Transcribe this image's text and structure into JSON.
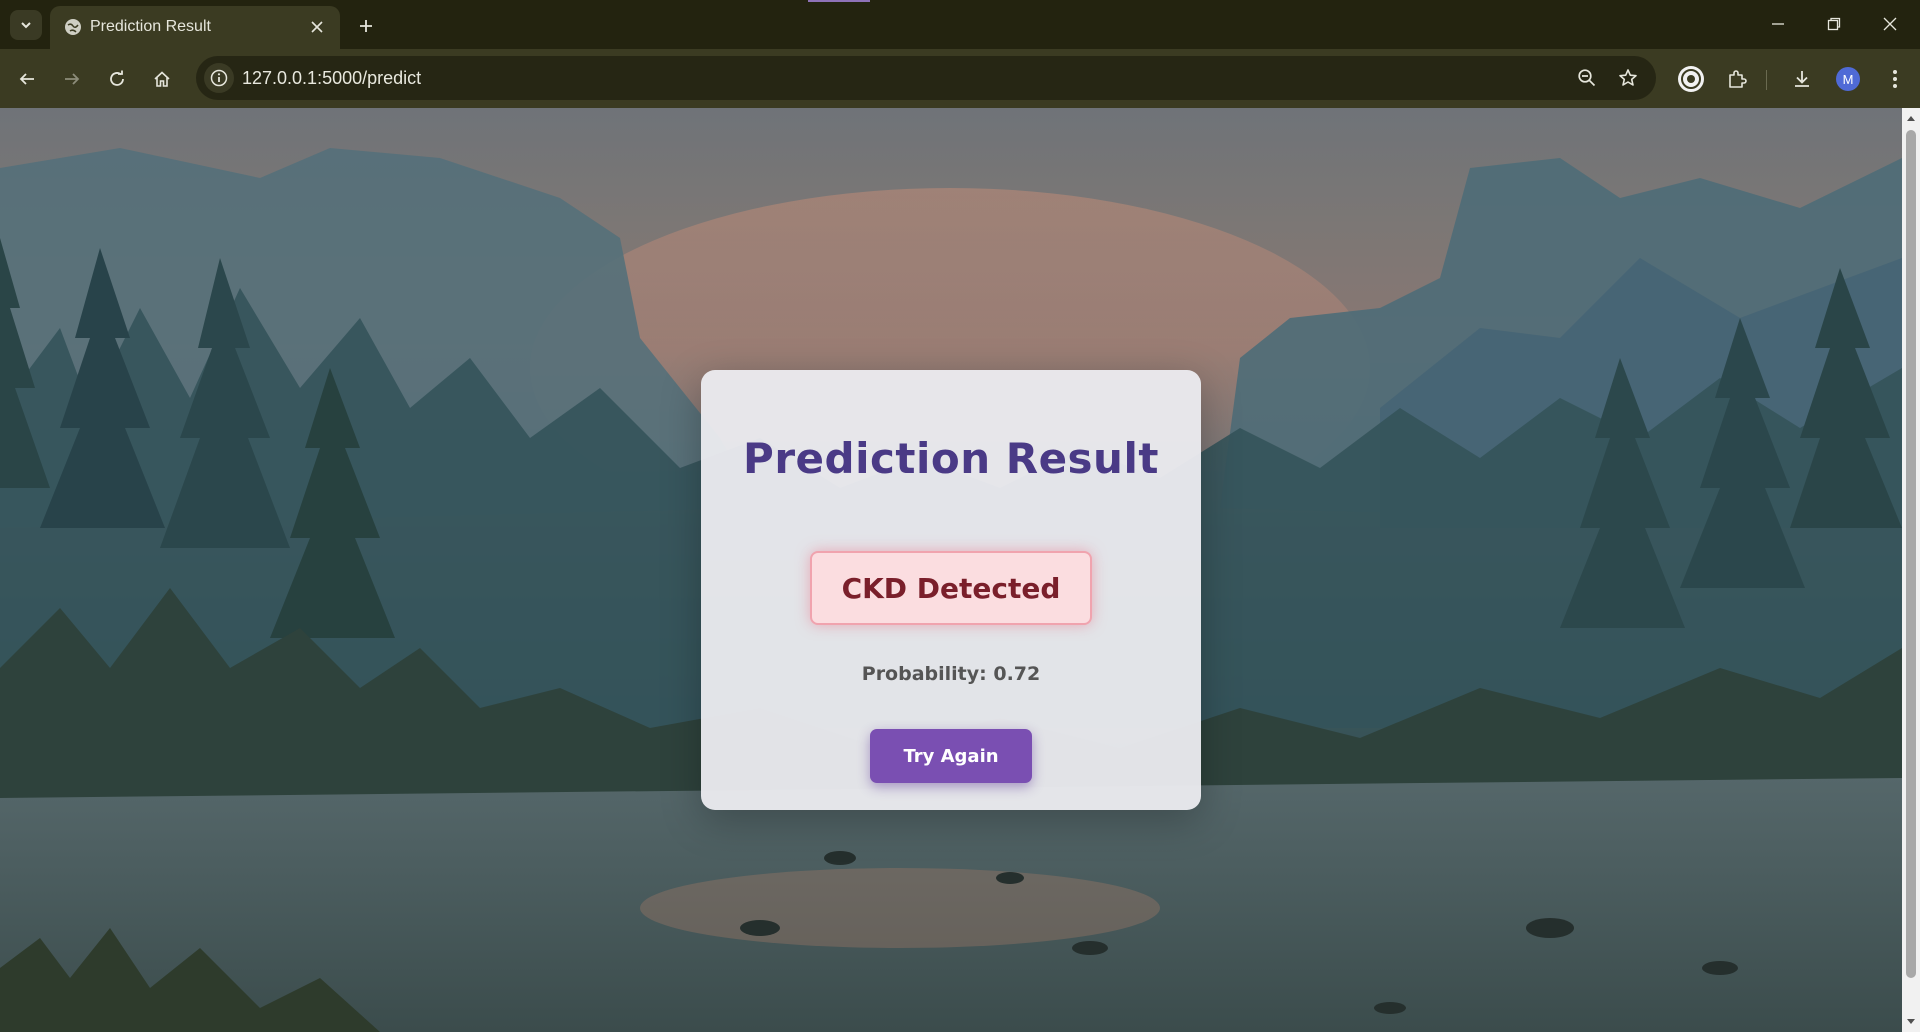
{
  "browser": {
    "tab": {
      "title": "Prediction Result"
    },
    "omnibox": {
      "url": "127.0.0.1:5000/predict"
    },
    "profile_initial": "M",
    "icons": {
      "tab_search": "chevron-down-icon",
      "favicon": "globe-icon",
      "tab_close": "close-icon",
      "new_tab": "plus-icon",
      "minimize": "minimize-icon",
      "restore": "restore-icon",
      "close_window": "close-icon",
      "back": "arrow-left-icon",
      "forward": "arrow-right-icon",
      "reload": "reload-icon",
      "home": "home-icon",
      "site_info": "info-icon",
      "zoom": "zoom-out-icon",
      "bookmark": "star-icon",
      "extension_circle": "extension-circle-icon",
      "extensions": "puzzle-icon",
      "downloads": "download-icon",
      "menu": "kebab-menu-icon"
    }
  },
  "page": {
    "title": "Prediction Result",
    "result": "CKD Detected",
    "probability": "Probability: 0.72",
    "button_label": "Try Again"
  },
  "colors": {
    "title": "#4a3a86",
    "result_text": "#7a1f2b",
    "result_bg": "#fbdde0",
    "button_bg": "#7a4fb2"
  }
}
